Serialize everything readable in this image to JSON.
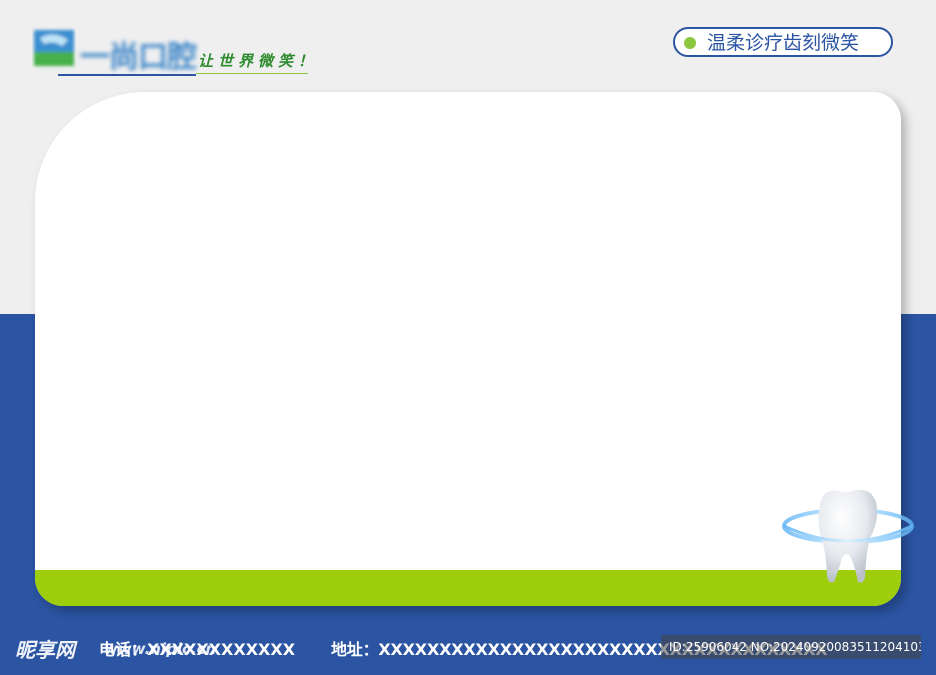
{
  "logo": {
    "name": "一尚口腔",
    "slogan": "让世界微笑！"
  },
  "tagline": "温柔诊疗齿刻微笑",
  "footer": {
    "phone": "电话：XXXXXXXXXXXX",
    "address": "地址：XXXXXXXXXXXXXXXXXXXXXXXXXXXXXXXXXXXXX"
  },
  "watermark": {
    "brand": "昵享网",
    "url": "www.nipic.cn",
    "id": "ID:25906042 NO:20240920083511204103"
  },
  "colors": {
    "blue": "#2b54a2",
    "green": "#9ecd0c",
    "background": "#efeff0"
  },
  "icons": [
    "logo-mark-icon",
    "tooth-icon"
  ]
}
